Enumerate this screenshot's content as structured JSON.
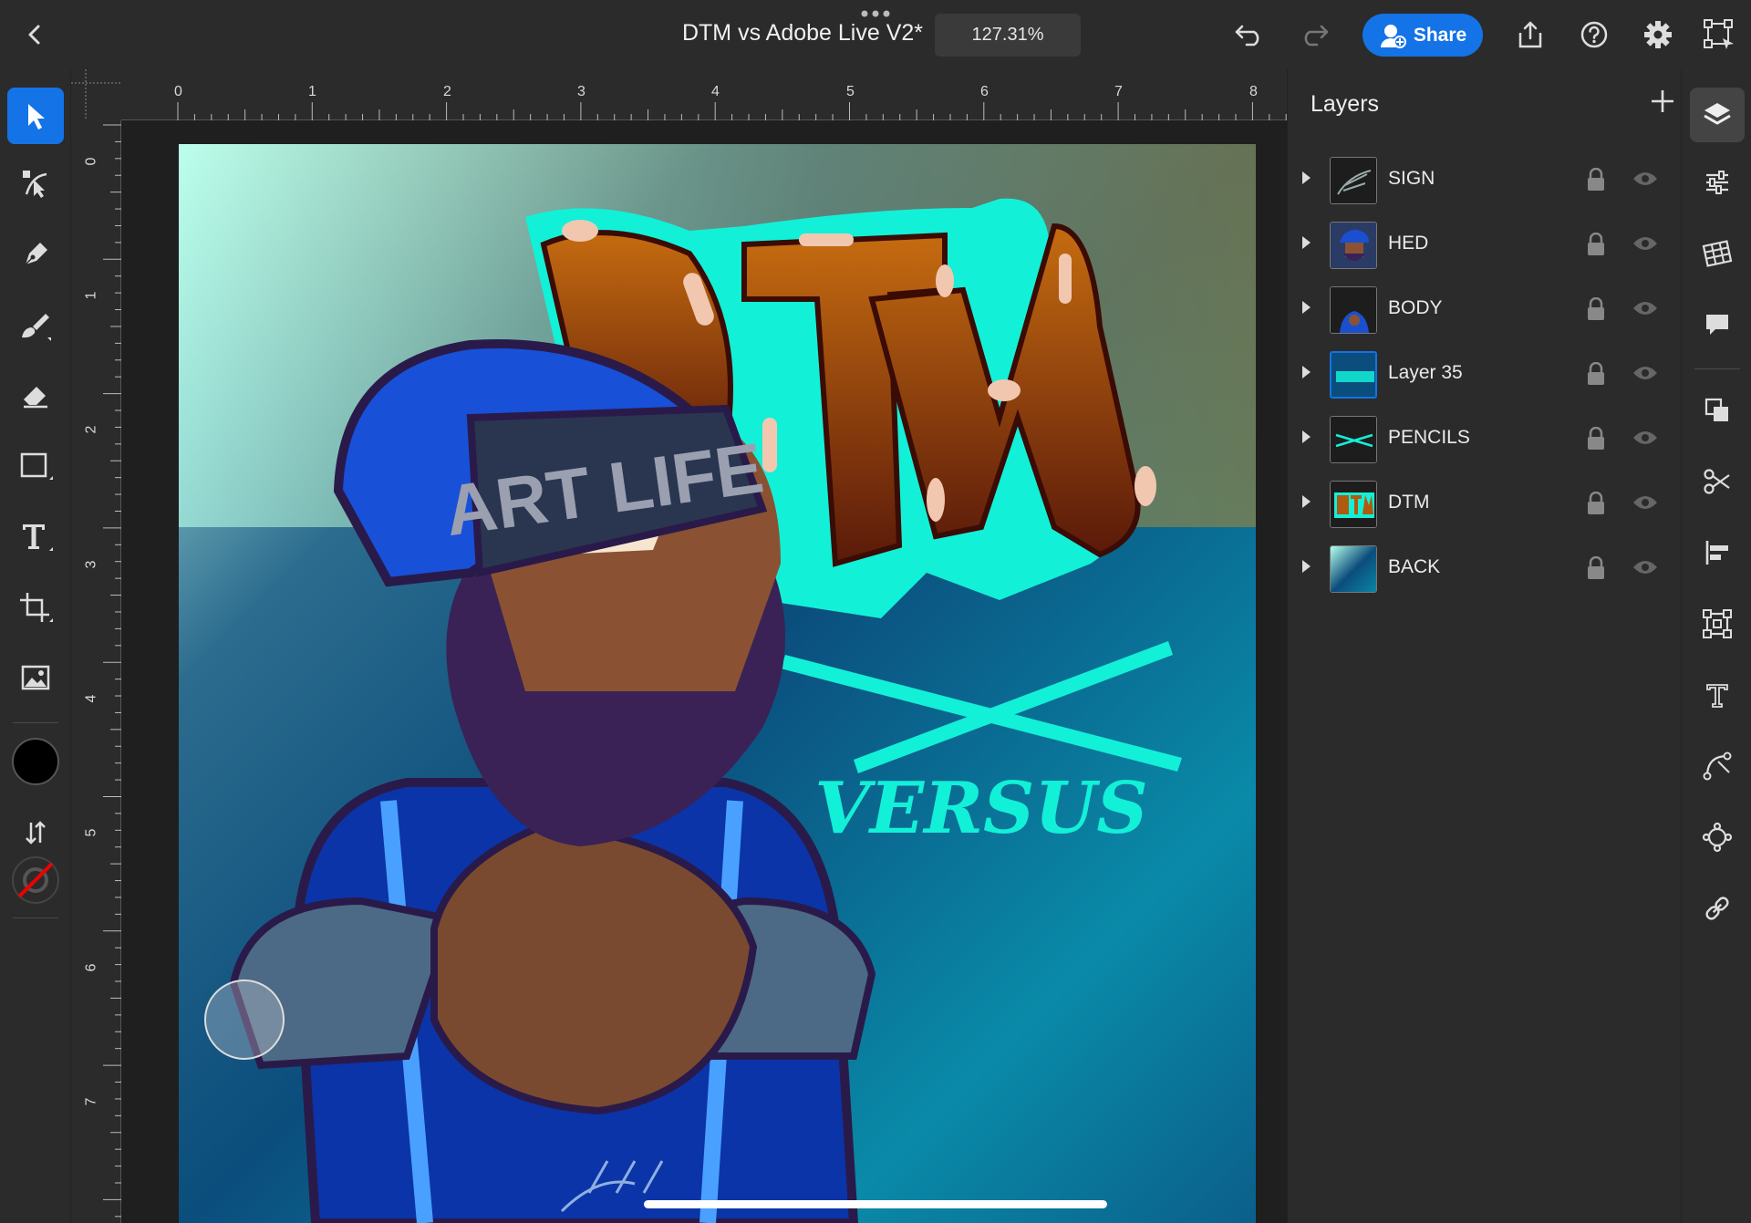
{
  "document": {
    "title": "DTM vs Adobe Live V2*",
    "zoom": "127.31%"
  },
  "toolbar": {
    "share_label": "Share"
  },
  "ruler": {
    "horizontal": [
      "0",
      "1",
      "2",
      "3",
      "4",
      "5",
      "6",
      "7",
      "8"
    ],
    "vertical": [
      "0",
      "1",
      "2",
      "3",
      "4",
      "5",
      "6",
      "7"
    ]
  },
  "left_tools": [
    "select",
    "direct-select",
    "pen",
    "brush",
    "eraser",
    "rectangle",
    "text",
    "crop",
    "image",
    "fill-color",
    "swap",
    "stroke-color"
  ],
  "colors": {
    "accent": "#1473e6",
    "fill": "#000000",
    "stroke": "none",
    "panel_bg": "#2b2b2b"
  },
  "layers_panel": {
    "title": "Layers",
    "layers": [
      {
        "name": "SIGN",
        "locked": true,
        "visible": true
      },
      {
        "name": "HED",
        "locked": true,
        "visible": true
      },
      {
        "name": "BODY",
        "locked": true,
        "visible": true
      },
      {
        "name": "Layer 35",
        "locked": true,
        "visible": true,
        "selected": true
      },
      {
        "name": "PENCILS",
        "locked": true,
        "visible": true
      },
      {
        "name": "DTM",
        "locked": true,
        "visible": true
      },
      {
        "name": "BACK",
        "locked": true,
        "visible": true
      }
    ]
  },
  "artwork": {
    "cap_text": "ART LIFE",
    "title_text": "DTM",
    "subtitle_text": "VERSUS"
  }
}
